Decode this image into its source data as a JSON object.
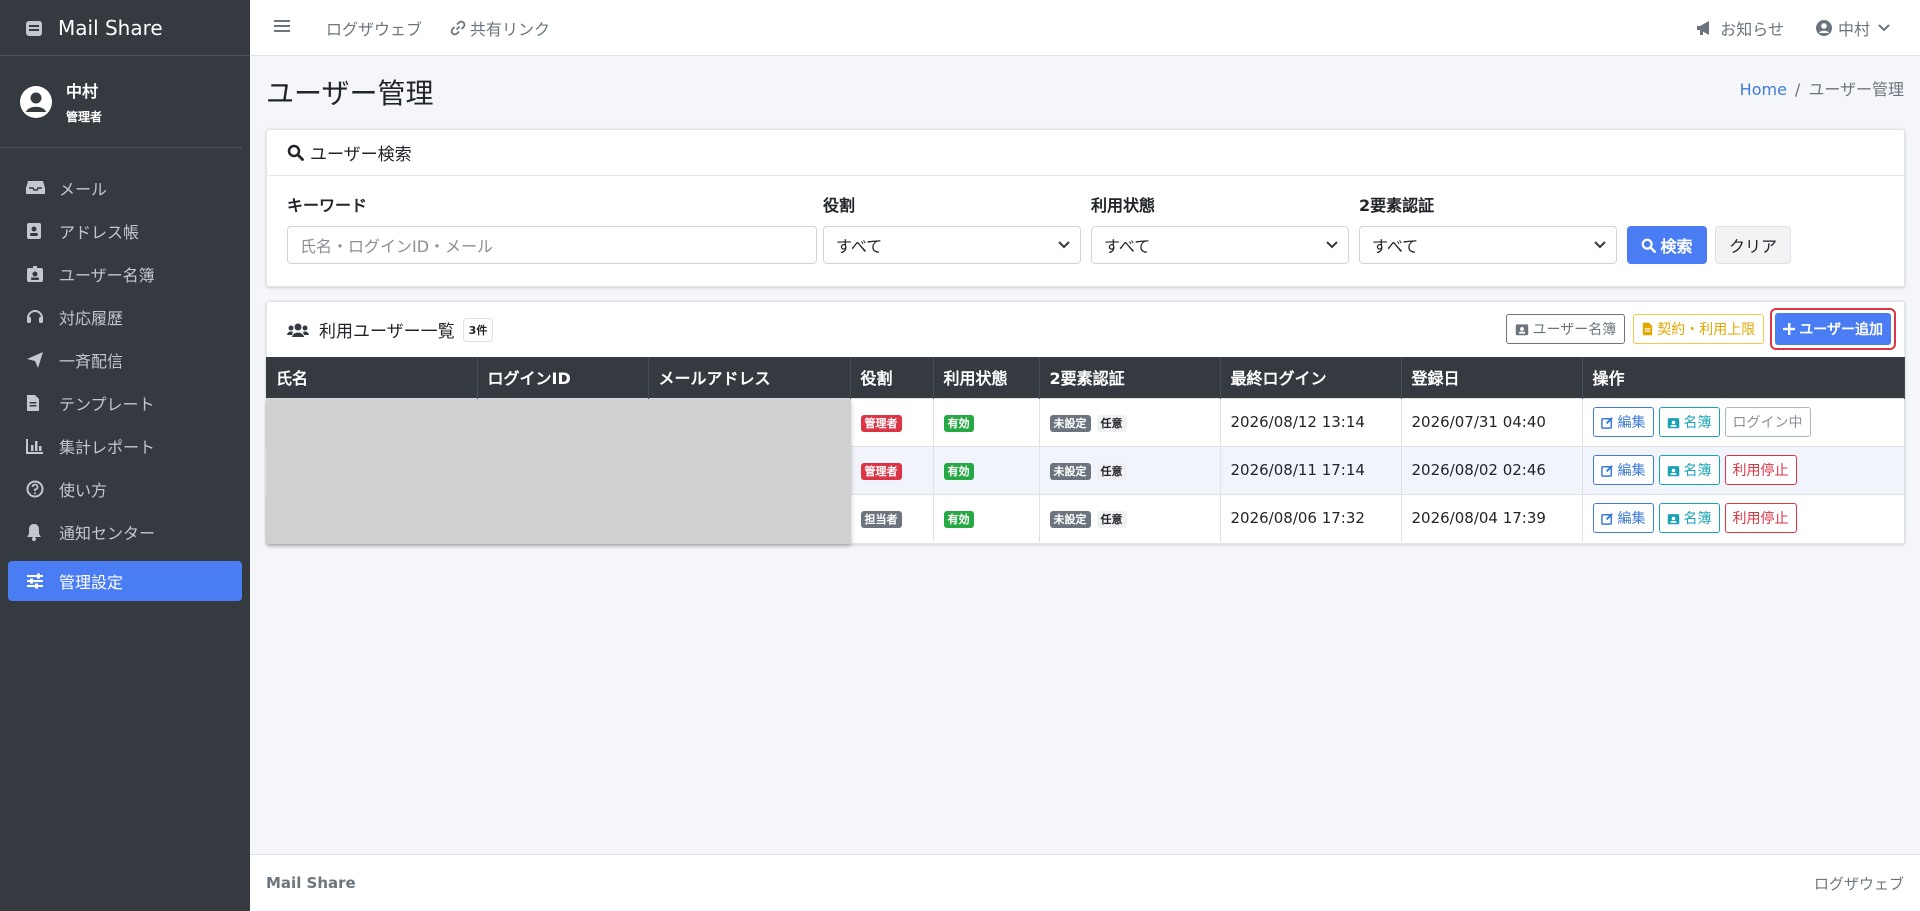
{
  "brand": {
    "name": "Mail Share"
  },
  "user": {
    "name": "中村",
    "role": "管理者"
  },
  "nav": [
    {
      "label": "メール",
      "icon": "inbox-icon"
    },
    {
      "label": "アドレス帳",
      "icon": "address-book-icon"
    },
    {
      "label": "ユーザー名簿",
      "icon": "id-badge-icon"
    },
    {
      "label": "対応履歴",
      "icon": "headset-icon"
    },
    {
      "label": "一斉配信",
      "icon": "paper-plane-icon"
    },
    {
      "label": "テンプレート",
      "icon": "file-icon"
    },
    {
      "label": "集計レポート",
      "icon": "chart-icon"
    },
    {
      "label": "使い方",
      "icon": "question-icon"
    },
    {
      "label": "通知センター",
      "icon": "bell-icon"
    },
    {
      "label": "管理設定",
      "icon": "sliders-icon",
      "active": true
    }
  ],
  "topbar": {
    "link1": "ログザウェブ",
    "link2": "共有リンク",
    "notice": "お知らせ",
    "user": "中村"
  },
  "page": {
    "title": "ユーザー管理",
    "breadcrumb_home": "Home",
    "breadcrumb_sep": "/",
    "breadcrumb_current": "ユーザー管理"
  },
  "search": {
    "title": "ユーザー検索",
    "keyword_label": "キーワード",
    "keyword_placeholder": "氏名・ログインID・メール",
    "role_label": "役割",
    "role_value": "すべて",
    "status_label": "利用状態",
    "status_value": "すべて",
    "twofa_label": "2要素認証",
    "twofa_value": "すべて",
    "search_btn": "検索",
    "clear_btn": "クリア"
  },
  "list": {
    "title": "利用ユーザー一覧",
    "count": "3件",
    "btn_directory": "ユーザー名簿",
    "btn_contract": "契約・利用上限",
    "btn_add": "ユーザー追加",
    "columns": [
      "氏名",
      "ログインID",
      "メールアドレス",
      "役割",
      "利用状態",
      "2要素認証",
      "最終ログイン",
      "登録日",
      "操作"
    ],
    "rows": [
      {
        "role": "管理者",
        "status": "有効",
        "twofa": "未設定",
        "twofa_opt": "任意",
        "last_login": "2026/08/12 13:14",
        "registered": "2026/07/31 04:40",
        "edit": "編集",
        "dir": "名簿",
        "action": "ログイン中"
      },
      {
        "role": "管理者",
        "status": "有効",
        "twofa": "未設定",
        "twofa_opt": "任意",
        "last_login": "2026/08/11 17:14",
        "registered": "2026/08/02 02:46",
        "edit": "編集",
        "dir": "名簿",
        "action": "利用停止"
      },
      {
        "role": "担当者",
        "status": "有効",
        "twofa": "未設定",
        "twofa_opt": "任意",
        "last_login": "2026/08/06 17:32",
        "registered": "2026/08/04 17:39",
        "edit": "編集",
        "dir": "名簿",
        "action": "利用停止"
      }
    ]
  },
  "footer": {
    "left": "Mail Share",
    "right": "ログザウェブ"
  },
  "colors": {
    "sidebar": "#343a40",
    "primary": "#4a7cf3",
    "danger": "#dc3545",
    "success": "#28a745"
  }
}
